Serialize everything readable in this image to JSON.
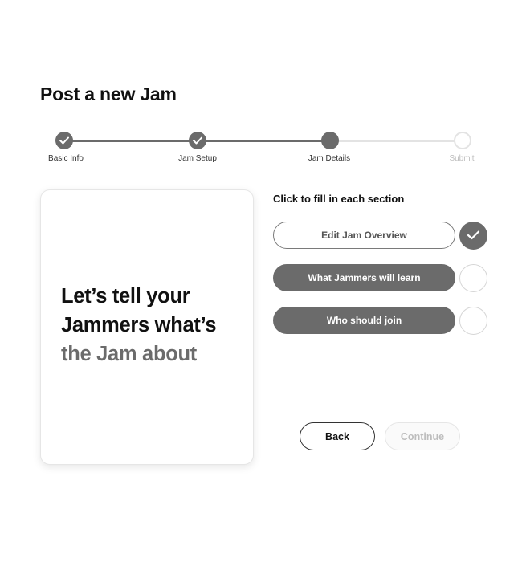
{
  "page": {
    "title": "Post a new Jam"
  },
  "stepper": {
    "steps": [
      {
        "label": "Basic Info",
        "state": "complete"
      },
      {
        "label": "Jam Setup",
        "state": "complete"
      },
      {
        "label": "Jam Details",
        "state": "current"
      },
      {
        "label": "Submit",
        "state": "pending"
      }
    ]
  },
  "card": {
    "line1": "Let’s tell your",
    "line2": "Jammers what’s",
    "line3": "the Jam about"
  },
  "sections": {
    "instruction": "Click to fill in each section",
    "items": [
      {
        "label": "Edit Jam Overview",
        "completed": true
      },
      {
        "label": "What Jammers will learn",
        "completed": false
      },
      {
        "label": "Who should join",
        "completed": false
      }
    ]
  },
  "nav": {
    "back_label": "Back",
    "continue_label": "Continue"
  },
  "colors": {
    "accent": "#6b6b6b",
    "muted": "#bdbdbd",
    "track_inactive": "#e3e3e3"
  },
  "icons": {
    "complete": "check-icon"
  }
}
